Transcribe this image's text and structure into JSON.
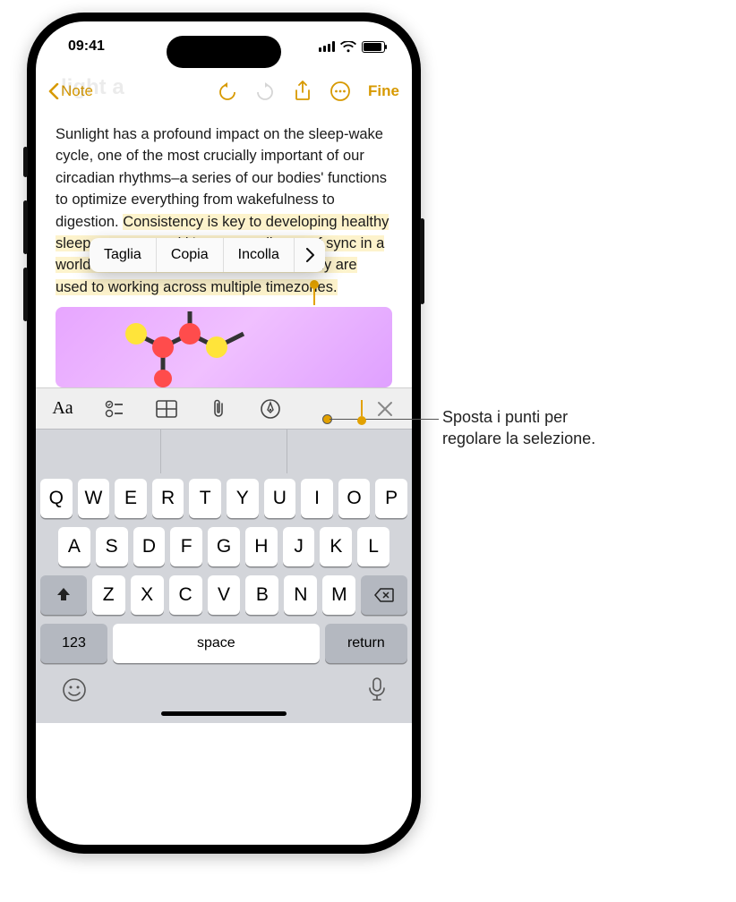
{
  "status": {
    "time": "09:41"
  },
  "nav": {
    "back_label": "Note",
    "done_label": "Fine"
  },
  "title_ghost": "light a",
  "note": {
    "pre": "Sunlight has a profound impact on the sleep-wake cycle, one of the most crucially important of our circadian rhythms–a series of                                                         our bodies' functions to optimize everything from wakefulness to digestion. ",
    "selected": "Consistency is key to developing healthy sleep patterns, and it's easy to slip out of sync in a world of constant connection, where many are used to working across multiple timezones."
  },
  "edit_menu": {
    "cut": "Taglia",
    "copy": "Copia",
    "paste": "Incolla"
  },
  "keyboard": {
    "row1": [
      "Q",
      "W",
      "E",
      "R",
      "T",
      "Y",
      "U",
      "I",
      "O",
      "P"
    ],
    "row2": [
      "A",
      "S",
      "D",
      "F",
      "G",
      "H",
      "J",
      "K",
      "L"
    ],
    "row3": [
      "Z",
      "X",
      "C",
      "V",
      "B",
      "N",
      "M"
    ],
    "num": "123",
    "space": "space",
    "return": "return"
  },
  "callout": {
    "text_a": "Sposta i punti per",
    "text_b": "regolare la selezione."
  }
}
